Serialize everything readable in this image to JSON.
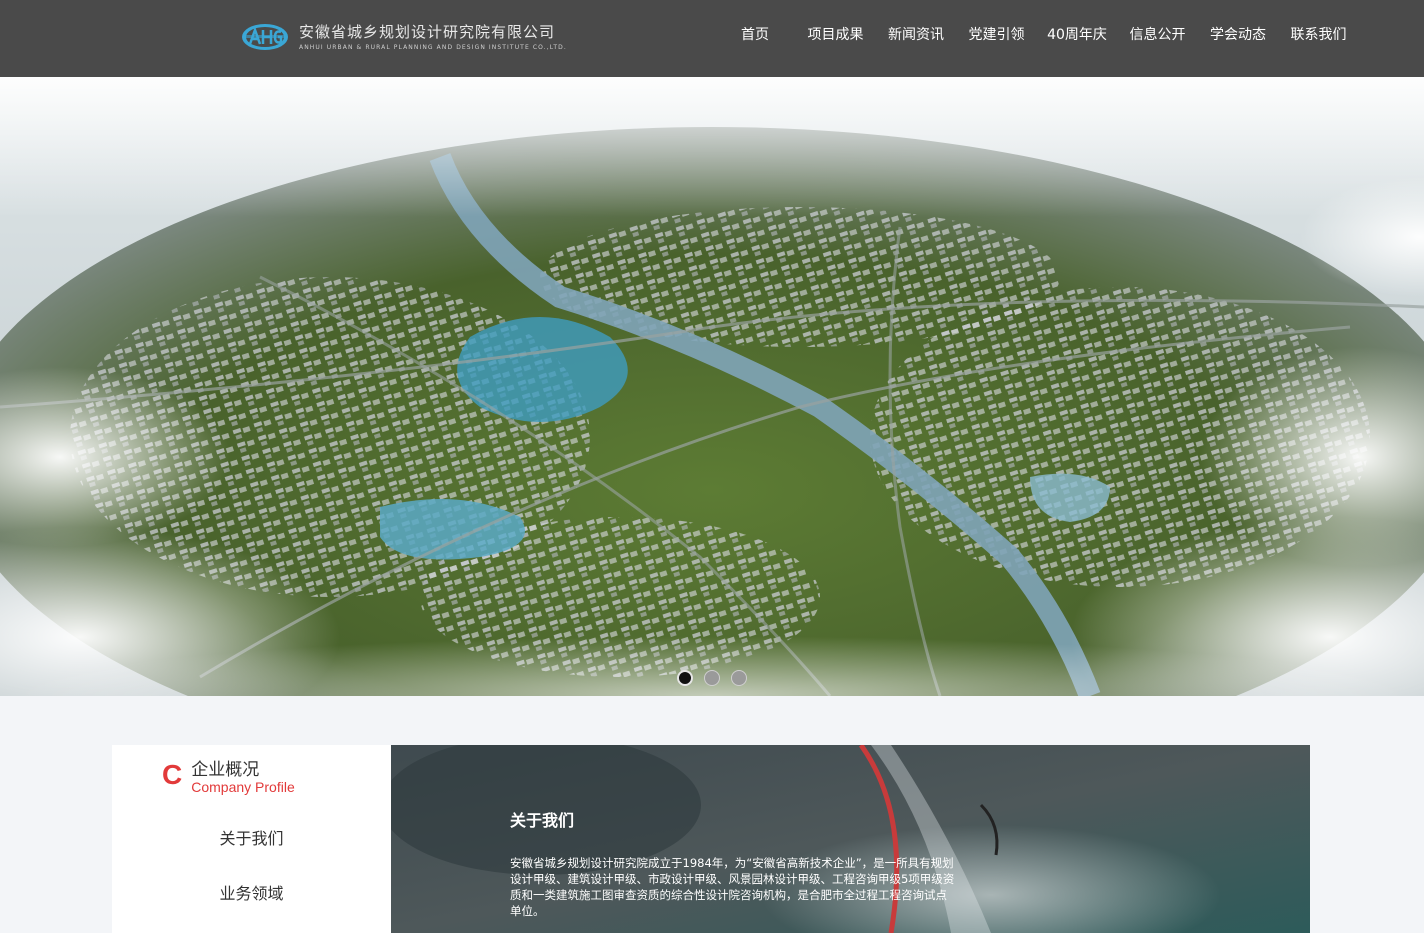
{
  "header": {
    "logo_cn": "安徽省城乡规划设计研究院有限公司",
    "logo_en": "ANHUI URBAN & RURAL PLANNING AND DESIGN INSTITUTE CO.,LTD.",
    "logo_icon": "ahurp-logo-icon",
    "nav": [
      {
        "label": "首页"
      },
      {
        "label": "项目成果"
      },
      {
        "label": "新闻资讯"
      },
      {
        "label": "党建引领"
      },
      {
        "label": "40周年庆"
      },
      {
        "label": "信息公开"
      },
      {
        "label": "学会动态"
      },
      {
        "label": "联系我们"
      }
    ]
  },
  "banner": {
    "slide_count": 3,
    "active_slide": 1
  },
  "company": {
    "letter": "C",
    "title_cn": "企业概况",
    "title_en": "Company Profile",
    "links": [
      {
        "label": "关于我们"
      },
      {
        "label": "业务领域"
      }
    ],
    "about_title": "关于我们",
    "about_text": "安徽省城乡规划设计研究院成立于1984年，为“安徽省高新技术企业”，是一所具有规划设计甲级、建筑设计甲级、市政设计甲级、风景园林设计甲级、工程咨询甲级5项甲级资质和一类建筑施工图审查资质的综合性设计院咨询机构，是合肥市全过程工程咨询试点单位。"
  },
  "colors": {
    "header_bg": "#4a4a4a",
    "accent_red": "#e23a3a",
    "page_bg": "#f3f5f8"
  }
}
